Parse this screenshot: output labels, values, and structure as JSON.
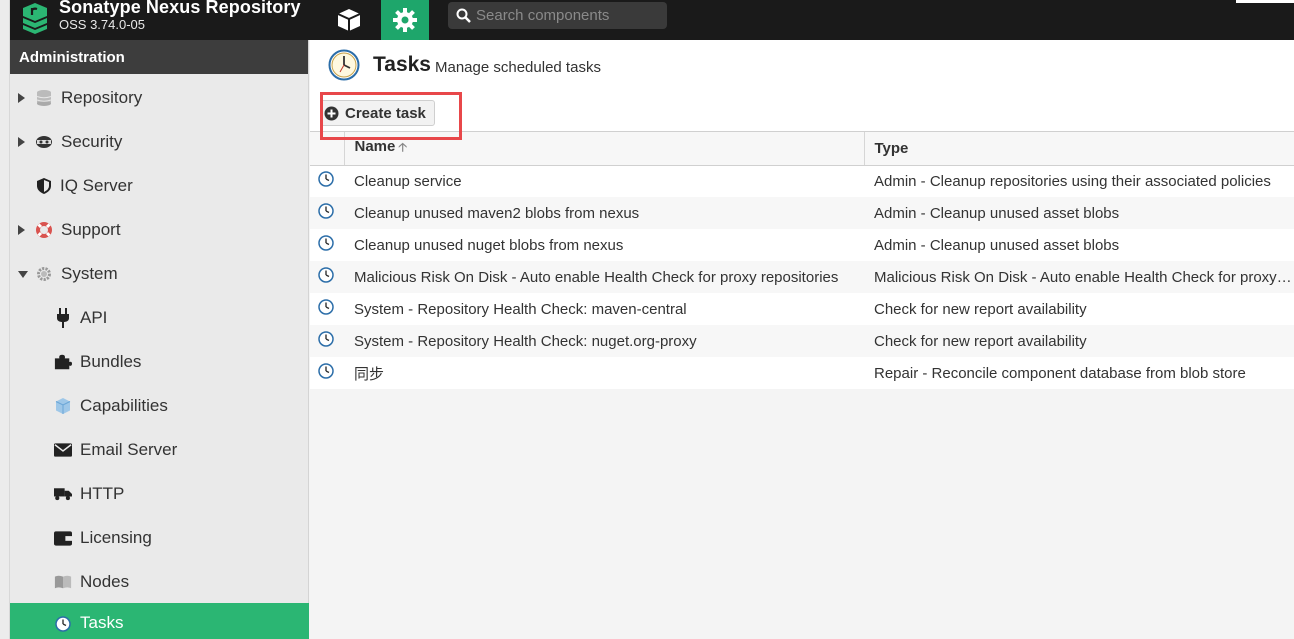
{
  "app": {
    "title": "Sonatype Nexus Repository",
    "version": "OSS 3.74.0-05"
  },
  "header": {
    "browse_icon": "cube-icon",
    "admin_icon": "gear-icon",
    "search": {
      "placeholder": "Search components",
      "value": ""
    }
  },
  "sidebar": {
    "heading": "Administration",
    "items": [
      {
        "label": "Repository",
        "icon": "database-icon",
        "expand": "collapsed"
      },
      {
        "label": "Security",
        "icon": "security-icon",
        "expand": "collapsed"
      },
      {
        "label": "IQ Server",
        "icon": "shield-icon",
        "expand": "none"
      },
      {
        "label": "Support",
        "icon": "lifebuoy-icon",
        "expand": "collapsed"
      },
      {
        "label": "System",
        "icon": "gear-icon",
        "expand": "expanded"
      },
      {
        "label": "API",
        "icon": "plug-icon",
        "expand": "none"
      },
      {
        "label": "Bundles",
        "icon": "puzzle-icon",
        "expand": "none"
      },
      {
        "label": "Capabilities",
        "icon": "cube-icon",
        "expand": "none"
      },
      {
        "label": "Email Server",
        "icon": "envelope-icon",
        "expand": "none"
      },
      {
        "label": "HTTP",
        "icon": "truck-icon",
        "expand": "none"
      },
      {
        "label": "Licensing",
        "icon": "wallet-icon",
        "expand": "none"
      },
      {
        "label": "Nodes",
        "icon": "book-icon",
        "expand": "none"
      },
      {
        "label": "Tasks",
        "icon": "clock-icon",
        "expand": "none",
        "active": true
      }
    ],
    "active_color": "#2bb673"
  },
  "page": {
    "title": "Tasks",
    "subtitle": "Manage scheduled tasks",
    "create_button": "Create task",
    "highlight_color": "#e8474a"
  },
  "table": {
    "columns": [
      "Name",
      "Type"
    ],
    "rows": [
      {
        "name": "Cleanup service",
        "type": "Admin - Cleanup repositories using their associated policies"
      },
      {
        "name": "Cleanup unused maven2 blobs from nexus",
        "type": "Admin - Cleanup unused asset blobs"
      },
      {
        "name": "Cleanup unused nuget blobs from nexus",
        "type": "Admin - Cleanup unused asset blobs"
      },
      {
        "name": "Malicious Risk On Disk - Auto enable Health Check for proxy repositories",
        "type": "Malicious Risk On Disk - Auto enable Health Check for proxy repositories"
      },
      {
        "name": "System - Repository Health Check: maven-central",
        "type": "Check for new report availability"
      },
      {
        "name": "System - Repository Health Check: nuget.org-proxy",
        "type": "Check for new report availability"
      },
      {
        "name": "同步",
        "type": "Repair - Reconcile component database from blob store"
      }
    ]
  }
}
